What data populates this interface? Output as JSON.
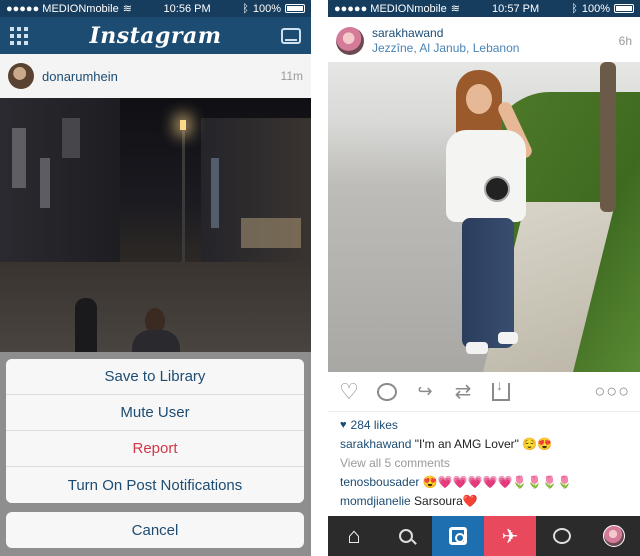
{
  "left": {
    "status": {
      "carrier": "●●●●● MEDIONmobile",
      "time": "10:56 PM",
      "battery": "100%"
    },
    "header": {
      "logo": "Instagram"
    },
    "post": {
      "username": "donarumhein",
      "time": "11m"
    },
    "sheet": {
      "items": [
        {
          "label": "Save to Library"
        },
        {
          "label": "Mute User"
        },
        {
          "label": "Report"
        },
        {
          "label": "Turn On Post Notifications"
        }
      ],
      "cancel": "Cancel"
    }
  },
  "right": {
    "status": {
      "carrier": "●●●●● MEDIONmobile",
      "time": "10:57 PM",
      "battery": "100%"
    },
    "post": {
      "username": "sarakhawand",
      "location": "Jezzîne, Al Janub, Lebanon",
      "time": "6h",
      "likes": "284 likes",
      "caption_user": "sarakhawand",
      "caption_text": "\"I'm an AMG Lover\" 😌😍",
      "view_all": "View all 5 comments",
      "comments": [
        {
          "user": "tenosbousader",
          "text": "😍💗💗💗💗💗🌷🌷🌷🌷"
        },
        {
          "user": "momdjianelie",
          "text": "Sarsoura❤️"
        }
      ]
    },
    "actions": {
      "more": "○○○"
    }
  },
  "colors": {
    "header": "#1d4c73",
    "link": "#4a84b6",
    "danger": "#d0394a",
    "camera_tab": "#1e6fb0",
    "plane_tab": "#e9495c"
  }
}
